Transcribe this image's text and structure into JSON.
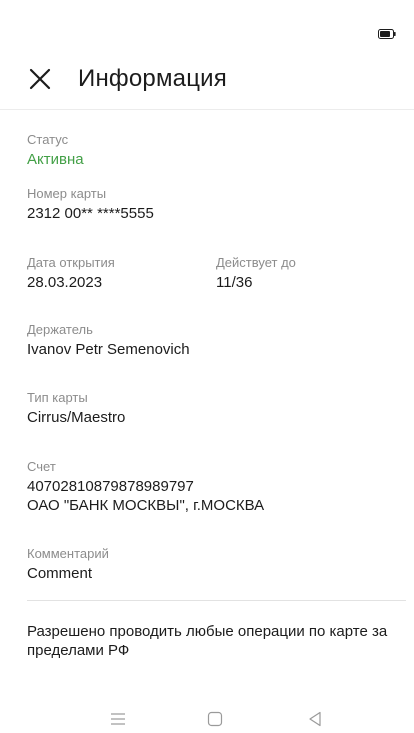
{
  "header": {
    "title": "Информация",
    "close_icon": "close-icon"
  },
  "status_bar": {
    "battery_icon": "battery-icon"
  },
  "fields": {
    "status": {
      "label": "Статус",
      "value": "Активна"
    },
    "card_number": {
      "label": "Номер карты",
      "value": "2312 00** ****5555"
    },
    "open_date": {
      "label": "Дата открытия",
      "value": "28.03.2023"
    },
    "valid_until": {
      "label": "Действует до",
      "value": "11/36"
    },
    "holder": {
      "label": "Держатель",
      "value": "Ivanov Petr Semenovich"
    },
    "card_type": {
      "label": "Тип карты",
      "value": "Cirrus/Maestro"
    },
    "account": {
      "label": "Счет",
      "value_line1": "40702810879878989797",
      "value_line2": "ОАО \"БАНК МОСКВЫ\", г.МОСКВА"
    },
    "comment": {
      "label": "Комментарий",
      "value": "Comment"
    }
  },
  "note": "Разрешено проводить любые операции по карте за пределами РФ",
  "colors": {
    "status_active": "#43a047",
    "label": "#8c8c8c",
    "text": "#1c1c1c"
  },
  "nav_bar": {
    "icons": [
      "menu-icon",
      "home-icon",
      "back-icon"
    ]
  }
}
